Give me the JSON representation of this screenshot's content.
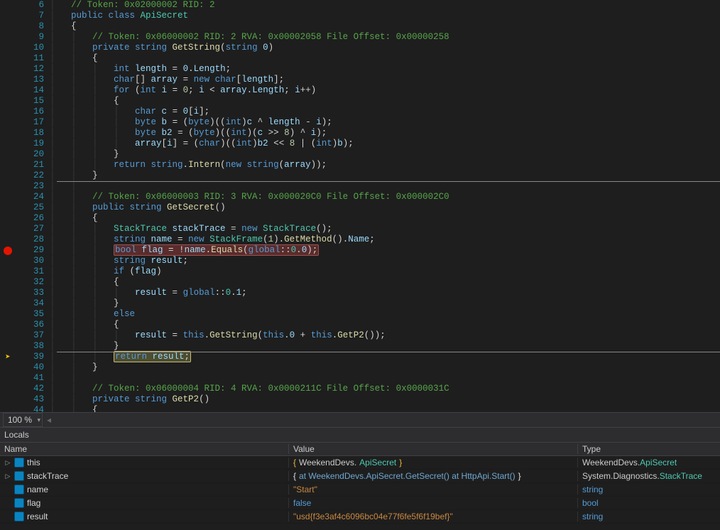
{
  "zoom": "100 %",
  "arrow_glyph": "➤",
  "lines": [
    {
      "n": 6,
      "glyph": "",
      "ind": "|   ",
      "segs": [
        [
          "c-comment",
          "// Token: 0x02000002 RID: 2"
        ]
      ]
    },
    {
      "n": 7,
      "glyph": "",
      "ind": "|   ",
      "segs": [
        [
          "c-keyword",
          "public class "
        ],
        [
          "c-type",
          "ApiSecret"
        ]
      ]
    },
    {
      "n": 8,
      "glyph": "",
      "ind": "|   ",
      "segs": [
        [
          "c-brace",
          "{"
        ]
      ]
    },
    {
      "n": 9,
      "glyph": "",
      "ind": "|   |   ",
      "segs": [
        [
          "c-comment",
          "// Token: 0x06000002 RID: 2 RVA: 0x00002058 File Offset: 0x00000258"
        ]
      ]
    },
    {
      "n": 10,
      "glyph": "",
      "ind": "|   |   ",
      "segs": [
        [
          "c-keyword",
          "private string "
        ],
        [
          "c-method",
          "GetString"
        ],
        [
          "c-brace",
          "("
        ],
        [
          "c-keyword",
          "string "
        ],
        [
          "c-var",
          "0"
        ],
        [
          "c-brace",
          ")"
        ]
      ]
    },
    {
      "n": 11,
      "glyph": "",
      "ind": "|   |   ",
      "segs": [
        [
          "c-brace",
          "{"
        ]
      ]
    },
    {
      "n": 12,
      "glyph": "",
      "ind": "|   |   |   ",
      "segs": [
        [
          "c-keyword",
          "int "
        ],
        [
          "c-var",
          "length"
        ],
        [
          "c-default",
          " = "
        ],
        [
          "c-var",
          "0"
        ],
        [
          "c-default",
          "."
        ],
        [
          "c-field",
          "Length"
        ],
        [
          "c-default",
          ";"
        ]
      ]
    },
    {
      "n": 13,
      "glyph": "",
      "ind": "|   |   |   ",
      "segs": [
        [
          "c-keyword",
          "char"
        ],
        [
          "c-brace",
          "[] "
        ],
        [
          "c-var",
          "array"
        ],
        [
          "c-default",
          " = "
        ],
        [
          "c-keyword",
          "new char"
        ],
        [
          "c-brace",
          "["
        ],
        [
          "c-var",
          "length"
        ],
        [
          "c-brace",
          "]"
        ],
        [
          "c-default",
          ";"
        ]
      ]
    },
    {
      "n": 14,
      "glyph": "",
      "ind": "|   |   |   ",
      "segs": [
        [
          "c-keyword",
          "for "
        ],
        [
          "c-brace",
          "("
        ],
        [
          "c-keyword",
          "int "
        ],
        [
          "c-var",
          "i"
        ],
        [
          "c-default",
          " = "
        ],
        [
          "c-num",
          "0"
        ],
        [
          "c-default",
          "; "
        ],
        [
          "c-var",
          "i"
        ],
        [
          "c-default",
          " < "
        ],
        [
          "c-var",
          "array"
        ],
        [
          "c-default",
          "."
        ],
        [
          "c-field",
          "Length"
        ],
        [
          "c-default",
          "; "
        ],
        [
          "c-var",
          "i"
        ],
        [
          "c-default",
          "++"
        ],
        [
          "c-brace",
          ")"
        ]
      ]
    },
    {
      "n": 15,
      "glyph": "",
      "ind": "|   |   |   ",
      "segs": [
        [
          "c-brace",
          "{"
        ]
      ]
    },
    {
      "n": 16,
      "glyph": "",
      "ind": "|   |   |   |   ",
      "segs": [
        [
          "c-keyword",
          "char "
        ],
        [
          "c-var",
          "c"
        ],
        [
          "c-default",
          " = "
        ],
        [
          "c-var",
          "0"
        ],
        [
          "c-brace",
          "["
        ],
        [
          "c-var",
          "i"
        ],
        [
          "c-brace",
          "]"
        ],
        [
          "c-default",
          ";"
        ]
      ]
    },
    {
      "n": 17,
      "glyph": "",
      "ind": "|   |   |   |   ",
      "segs": [
        [
          "c-keyword",
          "byte "
        ],
        [
          "c-var",
          "b"
        ],
        [
          "c-default",
          " = ("
        ],
        [
          "c-keyword",
          "byte"
        ],
        [
          "c-default",
          ")(("
        ],
        [
          "c-keyword",
          "int"
        ],
        [
          "c-default",
          ")"
        ],
        [
          "c-var",
          "c"
        ],
        [
          "c-default",
          " ^ "
        ],
        [
          "c-var",
          "length"
        ],
        [
          "c-default",
          " - "
        ],
        [
          "c-var",
          "i"
        ],
        [
          "c-default",
          ");"
        ]
      ]
    },
    {
      "n": 18,
      "glyph": "",
      "ind": "|   |   |   |   ",
      "segs": [
        [
          "c-keyword",
          "byte "
        ],
        [
          "c-var",
          "b2"
        ],
        [
          "c-default",
          " = ("
        ],
        [
          "c-keyword",
          "byte"
        ],
        [
          "c-default",
          ")(("
        ],
        [
          "c-keyword",
          "int"
        ],
        [
          "c-default",
          ")("
        ],
        [
          "c-var",
          "c"
        ],
        [
          "c-default",
          " >> "
        ],
        [
          "c-num",
          "8"
        ],
        [
          "c-default",
          ") ^ "
        ],
        [
          "c-var",
          "i"
        ],
        [
          "c-default",
          ");"
        ]
      ]
    },
    {
      "n": 19,
      "glyph": "",
      "ind": "|   |   |   |   ",
      "segs": [
        [
          "c-var",
          "array"
        ],
        [
          "c-brace",
          "["
        ],
        [
          "c-var",
          "i"
        ],
        [
          "c-brace",
          "]"
        ],
        [
          "c-default",
          " = ("
        ],
        [
          "c-keyword",
          "char"
        ],
        [
          "c-default",
          ")(("
        ],
        [
          "c-keyword",
          "int"
        ],
        [
          "c-default",
          ")"
        ],
        [
          "c-var",
          "b2"
        ],
        [
          "c-default",
          " << "
        ],
        [
          "c-num",
          "8"
        ],
        [
          "c-default",
          " | ("
        ],
        [
          "c-keyword",
          "int"
        ],
        [
          "c-default",
          ")"
        ],
        [
          "c-var",
          "b"
        ],
        [
          "c-default",
          ");"
        ]
      ]
    },
    {
      "n": 20,
      "glyph": "",
      "ind": "|   |   |   ",
      "segs": [
        [
          "c-brace",
          "}"
        ]
      ]
    },
    {
      "n": 21,
      "glyph": "",
      "ind": "|   |   |   ",
      "segs": [
        [
          "c-keyword",
          "return "
        ],
        [
          "c-keyword",
          "string"
        ],
        [
          "c-default",
          "."
        ],
        [
          "c-method",
          "Intern"
        ],
        [
          "c-brace",
          "("
        ],
        [
          "c-keyword",
          "new string"
        ],
        [
          "c-brace",
          "("
        ],
        [
          "c-var",
          "array"
        ],
        [
          "c-brace",
          "))"
        ],
        [
          "c-default",
          ";"
        ]
      ]
    },
    {
      "n": 22,
      "glyph": "",
      "ind": "|   |   ",
      "segs": [
        [
          "c-brace",
          "}"
        ]
      ],
      "sep_after": true
    },
    {
      "n": 23,
      "glyph": "",
      "ind": "|   |   ",
      "segs": [
        [
          "c-default",
          ""
        ]
      ]
    },
    {
      "n": 24,
      "glyph": "",
      "ind": "|   |   ",
      "segs": [
        [
          "c-comment",
          "// Token: 0x06000003 RID: 3 RVA: 0x000020C0 File Offset: 0x000002C0"
        ]
      ]
    },
    {
      "n": 25,
      "glyph": "",
      "ind": "|   |   ",
      "segs": [
        [
          "c-keyword",
          "public string "
        ],
        [
          "c-method",
          "GetSecret"
        ],
        [
          "c-brace",
          "()"
        ]
      ]
    },
    {
      "n": 26,
      "glyph": "",
      "ind": "|   |   ",
      "segs": [
        [
          "c-brace",
          "{"
        ]
      ]
    },
    {
      "n": 27,
      "glyph": "",
      "ind": "|   |   |   ",
      "segs": [
        [
          "c-type",
          "StackTrace "
        ],
        [
          "c-var",
          "stackTrace"
        ],
        [
          "c-default",
          " = "
        ],
        [
          "c-keyword",
          "new "
        ],
        [
          "c-type",
          "StackTrace"
        ],
        [
          "c-brace",
          "()"
        ],
        [
          "c-default",
          ";"
        ]
      ]
    },
    {
      "n": 28,
      "glyph": "",
      "ind": "|   |   |   ",
      "segs": [
        [
          "c-keyword",
          "string "
        ],
        [
          "c-var",
          "name"
        ],
        [
          "c-default",
          " = "
        ],
        [
          "c-keyword",
          "new "
        ],
        [
          "c-type",
          "StackFrame"
        ],
        [
          "c-brace",
          "("
        ],
        [
          "c-num",
          "1"
        ],
        [
          "c-brace",
          ")"
        ],
        [
          "c-default",
          "."
        ],
        [
          "c-method",
          "GetMethod"
        ],
        [
          "c-brace",
          "()"
        ],
        [
          "c-default",
          "."
        ],
        [
          "c-field",
          "Name"
        ],
        [
          "c-default",
          ";"
        ]
      ]
    },
    {
      "n": 29,
      "glyph": "bp",
      "ind": "|   |   |   ",
      "hl": "bp",
      "segs": [
        [
          "c-keyword",
          "bool "
        ],
        [
          "c-var",
          "flag"
        ],
        [
          "c-default",
          " = !"
        ],
        [
          "c-var",
          "name"
        ],
        [
          "c-default",
          "."
        ],
        [
          "c-method",
          "Equals"
        ],
        [
          "c-brace",
          "("
        ],
        [
          "c-global",
          "global"
        ],
        [
          "c-default",
          "::"
        ],
        [
          "c-type",
          "0"
        ],
        [
          "c-default",
          "."
        ],
        [
          "c-field",
          "0"
        ],
        [
          "c-brace",
          ")"
        ],
        [
          "c-default",
          ";"
        ]
      ]
    },
    {
      "n": 30,
      "glyph": "",
      "ind": "|   |   |   ",
      "segs": [
        [
          "c-keyword",
          "string "
        ],
        [
          "c-var",
          "result"
        ],
        [
          "c-default",
          ";"
        ]
      ]
    },
    {
      "n": 31,
      "glyph": "",
      "ind": "|   |   |   ",
      "segs": [
        [
          "c-keyword",
          "if "
        ],
        [
          "c-brace",
          "("
        ],
        [
          "c-var",
          "flag"
        ],
        [
          "c-brace",
          ")"
        ]
      ]
    },
    {
      "n": 32,
      "glyph": "",
      "ind": "|   |   |   ",
      "segs": [
        [
          "c-brace",
          "{"
        ]
      ]
    },
    {
      "n": 33,
      "glyph": "",
      "ind": "|   |   |   |   ",
      "segs": [
        [
          "c-var",
          "result"
        ],
        [
          "c-default",
          " = "
        ],
        [
          "c-global",
          "global"
        ],
        [
          "c-default",
          "::"
        ],
        [
          "c-type",
          "0"
        ],
        [
          "c-default",
          "."
        ],
        [
          "c-field",
          "1"
        ],
        [
          "c-default",
          ";"
        ]
      ]
    },
    {
      "n": 34,
      "glyph": "",
      "ind": "|   |   |   ",
      "segs": [
        [
          "c-brace",
          "}"
        ]
      ]
    },
    {
      "n": 35,
      "glyph": "",
      "ind": "|   |   |   ",
      "segs": [
        [
          "c-keyword",
          "else"
        ]
      ]
    },
    {
      "n": 36,
      "glyph": "",
      "ind": "|   |   |   ",
      "segs": [
        [
          "c-brace",
          "{"
        ]
      ]
    },
    {
      "n": 37,
      "glyph": "",
      "ind": "|   |   |   |   ",
      "segs": [
        [
          "c-var",
          "result"
        ],
        [
          "c-default",
          " = "
        ],
        [
          "c-keyword",
          "this"
        ],
        [
          "c-default",
          "."
        ],
        [
          "c-method",
          "GetString"
        ],
        [
          "c-brace",
          "("
        ],
        [
          "c-keyword",
          "this"
        ],
        [
          "c-default",
          "."
        ],
        [
          "c-field",
          "0"
        ],
        [
          "c-default",
          " + "
        ],
        [
          "c-keyword",
          "this"
        ],
        [
          "c-default",
          "."
        ],
        [
          "c-method",
          "GetP2"
        ],
        [
          "c-brace",
          "())"
        ],
        [
          "c-default",
          ";"
        ]
      ]
    },
    {
      "n": 38,
      "glyph": "",
      "ind": "|   |   |   ",
      "segs": [
        [
          "c-brace",
          "}"
        ]
      ],
      "sep_after": true
    },
    {
      "n": 39,
      "glyph": "arrow",
      "ind": "|   |   |   ",
      "hl": "cur",
      "segs": [
        [
          "c-keyword",
          "return "
        ],
        [
          "c-var",
          "result"
        ],
        [
          "c-default",
          ";"
        ]
      ]
    },
    {
      "n": 40,
      "glyph": "",
      "ind": "|   |   ",
      "segs": [
        [
          "c-brace",
          "}"
        ]
      ]
    },
    {
      "n": 41,
      "glyph": "",
      "ind": "|   |   ",
      "segs": [
        [
          "c-default",
          ""
        ]
      ]
    },
    {
      "n": 42,
      "glyph": "",
      "ind": "|   |   ",
      "segs": [
        [
          "c-comment",
          "// Token: 0x06000004 RID: 4 RVA: 0x0000211C File Offset: 0x0000031C"
        ]
      ]
    },
    {
      "n": 43,
      "glyph": "",
      "ind": "|   |   ",
      "segs": [
        [
          "c-keyword",
          "private string "
        ],
        [
          "c-method",
          "GetP2"
        ],
        [
          "c-brace",
          "()"
        ]
      ]
    },
    {
      "n": 44,
      "glyph": "",
      "ind": "|   |   ",
      "segs": [
        [
          "c-brace",
          "{"
        ]
      ]
    }
  ],
  "locals": {
    "title": "Locals",
    "headers": {
      "name": "Name",
      "value": "Value",
      "type": "Type"
    },
    "rows": [
      {
        "expand": true,
        "name": "this",
        "value_segs": [
          [
            "v-curl",
            "{"
          ],
          [
            "v-plain",
            "WeekendDevs."
          ],
          [
            "v-type-cls",
            "ApiSecret"
          ],
          [
            "v-curl",
            "}"
          ]
        ],
        "type_segs": [
          [
            "v-plain",
            "WeekendDevs."
          ],
          [
            "v-type-cls",
            "ApiSecret"
          ]
        ]
      },
      {
        "expand": true,
        "name": "stackTrace",
        "value_segs": [
          [
            "v-brace",
            "{   "
          ],
          [
            "v-link",
            "at WeekendDevs.ApiSecret.GetSecret()     at HttpApi.Start()"
          ],
          [
            "v-brace",
            "}"
          ]
        ],
        "type_segs": [
          [
            "v-plain",
            "System.Diagnostics."
          ],
          [
            "v-type-cls",
            "StackTrace"
          ]
        ]
      },
      {
        "expand": false,
        "name": "name",
        "value_segs": [
          [
            "v-str",
            "\"Start\""
          ]
        ],
        "type_segs": [
          [
            "v-kw",
            "string"
          ]
        ]
      },
      {
        "expand": false,
        "name": "flag",
        "value_segs": [
          [
            "v-kw",
            "false"
          ]
        ],
        "type_segs": [
          [
            "v-kw",
            "bool"
          ]
        ]
      },
      {
        "expand": false,
        "name": "result",
        "value_segs": [
          [
            "v-str",
            "\"usd{f3e3af4c6096bc04e77f6fe5f6f19bef}\""
          ]
        ],
        "type_segs": [
          [
            "v-kw",
            "string"
          ]
        ]
      }
    ]
  }
}
